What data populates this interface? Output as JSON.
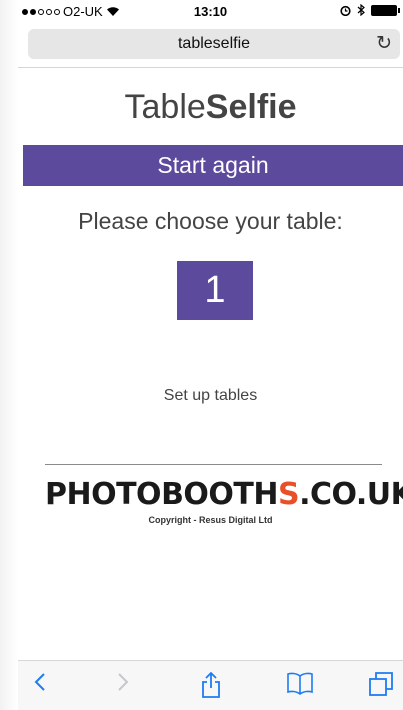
{
  "status_bar": {
    "carrier": "O2-UK",
    "time": "13:10"
  },
  "browser": {
    "url": "tableselfie"
  },
  "page": {
    "title_part1": "Table",
    "title_part2": "Selfie",
    "start_again_label": "Start again",
    "choose_prompt": "Please choose your table:",
    "table_number": "1",
    "setup_link": "Set up tables"
  },
  "footer": {
    "logo_part1": "PHOTOBOOTH",
    "logo_s": "S",
    "logo_part2": ".CO.UK",
    "copyright": "Copyright - Resus Digital Ltd"
  },
  "colors": {
    "accent": "#5c4a9d",
    "logo_s": "#e8502a",
    "toolbar_icons": "#1e7cf2"
  },
  "icons": [
    "signal-dots-icon",
    "wifi-icon",
    "alarm-icon",
    "bluetooth-icon",
    "battery-icon",
    "reload-icon",
    "back-icon",
    "forward-icon",
    "share-icon",
    "bookmarks-icon",
    "tabs-icon"
  ]
}
